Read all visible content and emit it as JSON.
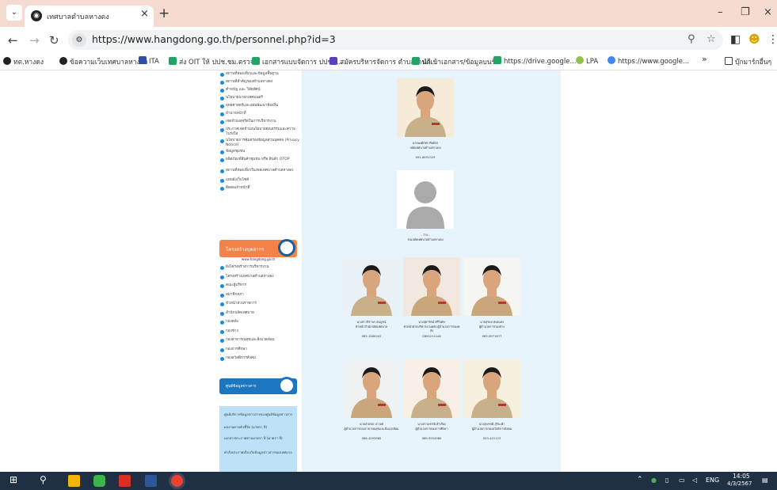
{
  "browser": {
    "tab_title": "เทศบาลตำบลหางดง",
    "url": "https://www.hangdong.go.th/personnel.php?id=3",
    "bookmarks": [
      "ทต.หางดง",
      "ข้อความเว็บเทศบาลหางดง",
      "ITA",
      "ส่ง OIT ให้ ปปช.ชม.ตรวจ",
      "เอกสารแบบจัดการ ปปชภ...",
      "สมัครบริหารจัดการ ตำบลงานดี...",
      "นำเข้าเอกสาร/ข้อมูลบนร์...",
      "https://drive.google...",
      "LPA",
      "https://www.google..."
    ],
    "bookmarks_more": "»",
    "other_bookmarks": "บุ๊กมาร์กอื่นๆ"
  },
  "sidebar": {
    "menu1": [
      "สถานที่ท่องเที่ยวและข้อมูลพื้นฐาน",
      "สถานที่สำคัญของตำบลหางดง",
      "คำขวัญ และ วิสัยทัศน์",
      "นโยบายนายกเทศมนตรี",
      "ยุทธศาสตร์และแผนพัฒนาท้องถิ่น",
      "อำนาจหน้าที่",
      "เจตจำนงสุจริตในการบริหารงาน",
      "ประกาศเจตจำนงนโยบายคุณธรรมและความโปร่งใส",
      "นโยบายการคุ้มครองข้อมูลส่วนบุคคล (Privacy Notice)",
      "ข้อมูลชุมชน",
      "ผลิตภัณฑ์สินค้าชุมชน หรือ สินค้า OTOP",
      "สถานที่ท่องเที่ยวในเขตเทศบาลตำบลหางดง",
      "แผนผังเว็บไซต์",
      "ติดต่อเจ้าหน้าที่"
    ],
    "personnel_title": "โครงสร้างบุคลากร",
    "personnel_sub": "www.hangdong.go.th",
    "menu2": [
      "ผังโครงสร้างการบริหารงาน",
      "โครงสร้างเทศบาลตำบลหางดง",
      "คณะผู้บริหาร",
      "สมาชิกสภา",
      "หัวหน้าส่วนราชการ",
      "สำนักปลัดเทศบาล",
      "กองคลัง",
      "กองช่าง",
      "กองสาธารณสุขและสิ่งแวดล้อม",
      "กองการศึกษา",
      "กองสวัสดิการสังคม"
    ],
    "info_title": "ศูนย์ข้อมูลข่าวสาร",
    "info_items": [
      "ศูนย์บริการข้อมูลข่าวสารของศูนย์ข้อมูลข่าวสาร",
      "ผลงานตามตัวชี้วัด (มาตรา 9)",
      "เอกสารประกาศตามมาตรา 9 (มาตรา 9)",
      "คำสั่งประกาศเกี่ยวกับข้อมูลข่าวสารของเทศบาล"
    ]
  },
  "people": [
    {
      "name": "นายพงศ์ภัทร ทิพย์จร",
      "pos": "ปลัดเทศบาลตำบลหางดง",
      "tel": "091-8491329"
    },
    {
      "name": "- ว่าง -",
      "pos": "รองปลัดเทศบาลตำบลหางดง",
      "tel": ""
    },
    {
      "name": "นางสาวจิราพร สมบูรณ์",
      "pos": "หัวหน้าสำนักปลัดเทศบาล",
      "tel": "083-1560202"
    },
    {
      "name": "นางสุดารัตน์ ศรีวิเศษ",
      "pos": "หัวหน้าฝ่ายบริหารงานคลัง ผู้อำนวยการกองคลัง",
      "tel": "0893211146"
    },
    {
      "name": "นายสุรพล ทองแดง",
      "pos": "ผู้อำนวยการกองช่าง",
      "tel": "063-0971677"
    },
    {
      "name": "นายสายชล ปาวงค์",
      "pos": "ผู้อำนวยการกองสาธารณสุขและสิ่งแวดล้อม",
      "tel": "086-4293965"
    },
    {
      "name": "นางสาวพรรณี คำเรือง",
      "pos": "ผู้อำนวยการกองการศึกษา",
      "tel": "089-5554980"
    },
    {
      "name": "นางสุพรรณี สุริยะคำ",
      "pos": "ผู้อำนวยการกองสวัสดิการสังคม",
      "tel": "053-441123"
    }
  ],
  "taskbar": {
    "lang": "ENG",
    "time": "14:05",
    "date": "4/3/2567"
  },
  "colors": {
    "tabstrip": "#f6dcd0",
    "main_bg": "#e7f4fb",
    "personnel_header": "#f2844a",
    "info_header": "#1d77c0",
    "taskbar": "#1f2f44"
  }
}
